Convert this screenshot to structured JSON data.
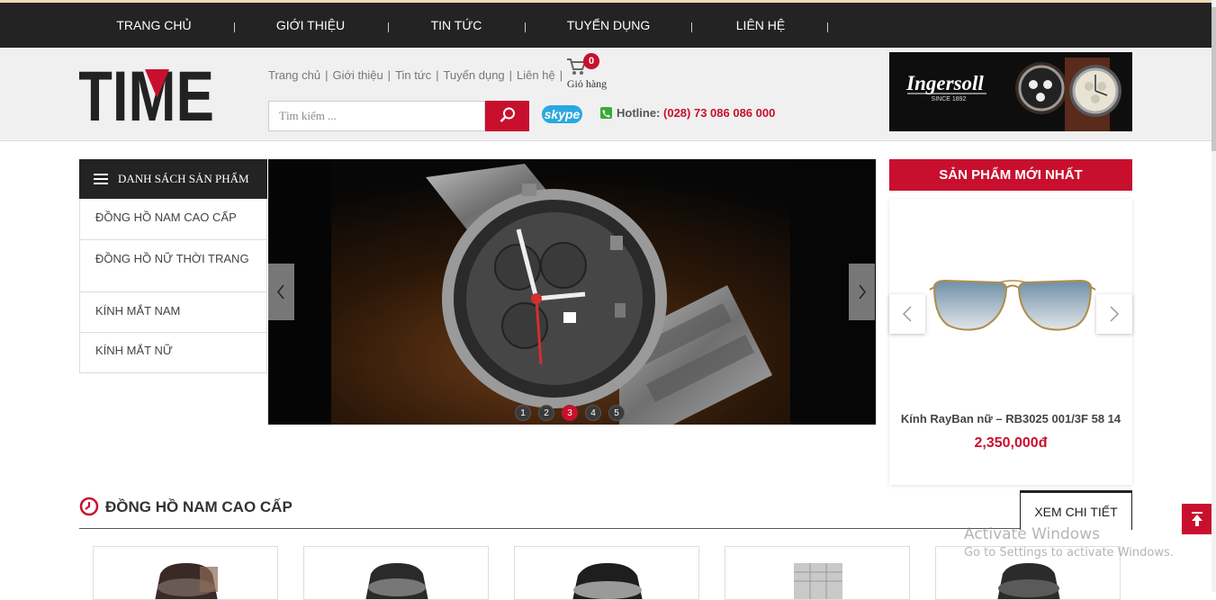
{
  "topnav": {
    "items": [
      {
        "label": "TRANG CHỦ"
      },
      {
        "label": "GIỚI THIỆU"
      },
      {
        "label": "TIN TỨC"
      },
      {
        "label": "TUYỂN DỤNG"
      },
      {
        "label": "LIÊN HỆ"
      }
    ]
  },
  "header": {
    "logo_text": "TIME",
    "links": [
      "Trang chủ",
      "Giới thiệu",
      "Tin tức",
      "Tuyển dụng",
      "Liên hệ"
    ],
    "cart": {
      "count": "0",
      "label": "Giỏ hàng"
    },
    "search": {
      "placeholder": "Tìm kiếm ..."
    },
    "skype_label": "skype",
    "hotline": {
      "label": "Hotline:",
      "number": "(028) 73 086 086 000"
    },
    "banner": {
      "brand": "Ingersoll",
      "since": "SINCE 1892"
    }
  },
  "categories": {
    "title": "DANH SÁCH SẢN PHẨM",
    "items": [
      "ĐỒNG HỒ NAM CAO CẤP",
      "ĐỒNG HỒ NỮ THỜI TRANG",
      "KÍNH MẮT NAM",
      "KÍNH MẮT NỮ"
    ]
  },
  "slider": {
    "dots": [
      "1",
      "2",
      "3",
      "4",
      "5"
    ],
    "active_index": 2
  },
  "newest": {
    "title": "SẢN PHẨM MỚI NHẤT",
    "product_name": "Kính RayBan nữ – RB3025 001/3F 58 14",
    "price": "2,350,000đ"
  },
  "section": {
    "title": "ĐỒNG HỒ NAM CAO CẤP",
    "more_label": "XEM CHI TIẾT"
  },
  "watermark": {
    "line1": "Activate Windows",
    "line2": "Go to Settings to activate Windows."
  },
  "colors": {
    "accent": "#c8102e",
    "nav_bg": "#232323"
  }
}
